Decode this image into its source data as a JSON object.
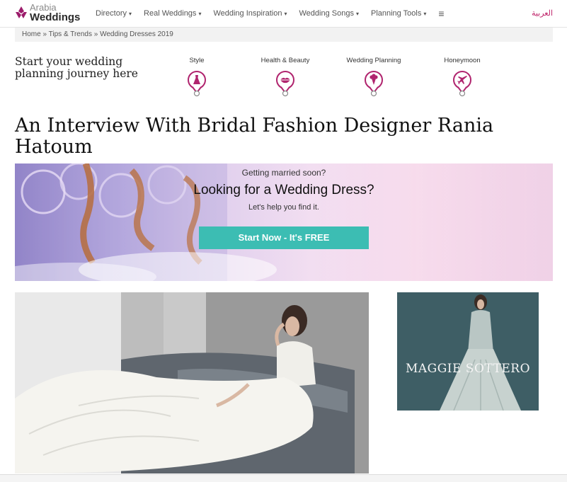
{
  "logo": {
    "line1": "Arabia",
    "line2": "Weddings"
  },
  "nav": {
    "items": [
      {
        "label": "Directory"
      },
      {
        "label": "Real Weddings"
      },
      {
        "label": "Wedding Inspiration"
      },
      {
        "label": "Wedding Songs"
      },
      {
        "label": "Planning Tools"
      }
    ],
    "menu_icon": "hamburger-icon",
    "language": "العربية"
  },
  "breadcrumb": {
    "home": "Home",
    "sep": "»",
    "section": "Tips & Trends",
    "current": "Wedding Dresses 2019"
  },
  "journey": {
    "text": "Start your wedding planning journey here"
  },
  "categories": [
    {
      "label": "Style",
      "icon": "dress-icon"
    },
    {
      "label": "Health & Beauty",
      "icon": "lips-icon"
    },
    {
      "label": "Wedding Planning",
      "icon": "bouquet-icon"
    },
    {
      "label": "Honeymoon",
      "icon": "airplane-icon"
    }
  ],
  "article": {
    "title": "An Interview With Bridal Fashion Designer Rania Hatoum"
  },
  "banner": {
    "line1": "Getting married soon?",
    "line2": "Looking for a Wedding Dress?",
    "line3": "Let's help you find it.",
    "cta": "Start Now - It's FREE"
  },
  "ad": {
    "brand": "MAGGIE SOTTERO"
  },
  "colors": {
    "brand": "#9c1c6b",
    "accent": "#c0256b",
    "cta": "#3cbdb3"
  }
}
